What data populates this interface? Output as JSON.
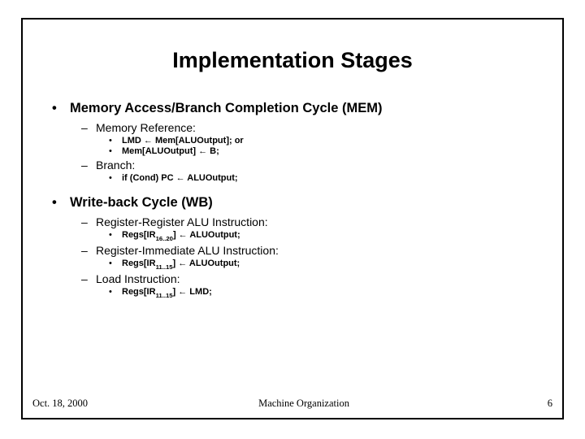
{
  "title": "Implementation Stages",
  "sec1": {
    "heading": "Memory Access/Branch Completion Cycle (MEM)",
    "sub1": {
      "heading": "Memory Reference:",
      "items": {
        "a_pre": "LMD ",
        "a_post": " Mem[ALUOutput];   or",
        "b_pre": "Mem[ALUOutput] ",
        "b_post": " B;"
      }
    },
    "sub2": {
      "heading": "Branch:",
      "items": {
        "a_pre": "if (Cond) PC ",
        "a_post": " ALUOutput;"
      }
    }
  },
  "sec2": {
    "heading": "Write-back Cycle (WB)",
    "sub1": {
      "heading": "Register-Register ALU Instruction:",
      "items": {
        "a_pre": "Regs[IR",
        "a_sub": "16..20",
        "a_mid": "] ",
        "a_post": " ALUOutput;"
      }
    },
    "sub2": {
      "heading": "Register-Immediate ALU Instruction:",
      "items": {
        "a_pre": "Regs[IR",
        "a_sub": "11..15",
        "a_mid": "] ",
        "a_post": " ALUOutput;"
      }
    },
    "sub3": {
      "heading": "Load Instruction:",
      "items": {
        "a_pre": "Regs[IR",
        "a_sub": "11..15",
        "a_mid": "] ",
        "a_post": " LMD;"
      }
    }
  },
  "footer": {
    "date": "Oct. 18, 2000",
    "center": "Machine Organization",
    "page": "6"
  },
  "glyphs": {
    "larrow": "←",
    "bullet1": "•",
    "bullet2": "–",
    "bullet3": "•"
  }
}
